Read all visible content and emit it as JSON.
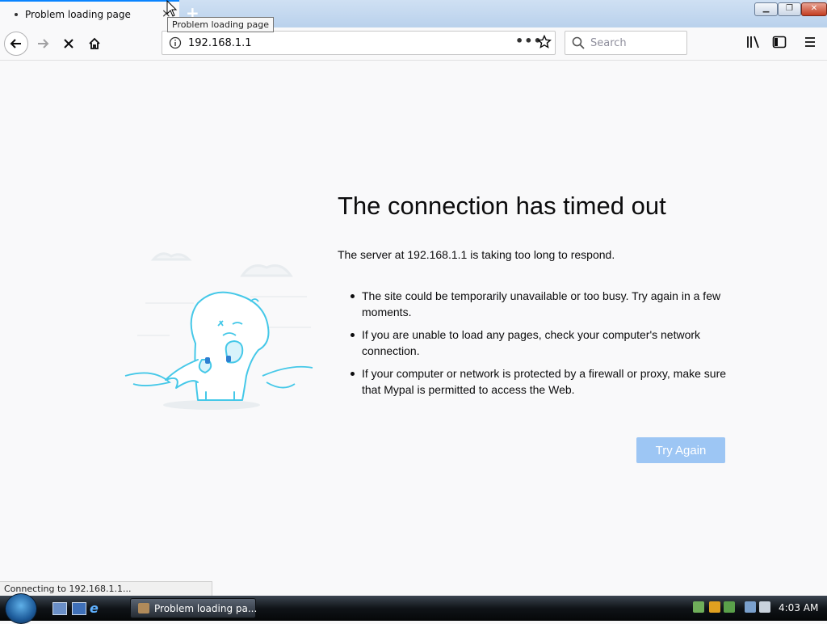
{
  "window": {
    "tab_title": "Problem loading page",
    "tab_close": "×",
    "new_tab": "+",
    "min_label": "▁",
    "max_label": "❐",
    "close_label": "✕"
  },
  "tooltip": "Problem loading page",
  "navbar": {
    "url": "192.168.1.1",
    "url_more": "•••",
    "search_placeholder": "Search"
  },
  "error": {
    "title": "The connection has timed out",
    "description": "The server at 192.168.1.1 is taking too long to respond.",
    "bullets": [
      "The site could be temporarily unavailable or too busy. Try again in a few moments.",
      "If you are unable to load any pages, check your computer's network connection.",
      "If your computer or network is protected by a firewall or proxy, make sure that Mypal is permitted to access the Web."
    ],
    "button": "Try Again"
  },
  "status": "Connecting to 192.168.1.1...",
  "taskbar": {
    "task_label": "Problem loading pa...",
    "clock": "4:03 AM"
  },
  "icons": {
    "back": "back-arrow-icon",
    "forward": "forward-arrow-icon",
    "stop": "stop-icon",
    "home": "home-icon",
    "info": "info-icon",
    "bookmark": "star-icon",
    "search": "search-icon",
    "library": "library-icon",
    "sidebar": "sidebar-icon",
    "menu": "hamburger-menu-icon"
  },
  "colors": {
    "accent": "#0a84ff",
    "button": "#9dc6f4",
    "illustration": "#45c8e8"
  }
}
